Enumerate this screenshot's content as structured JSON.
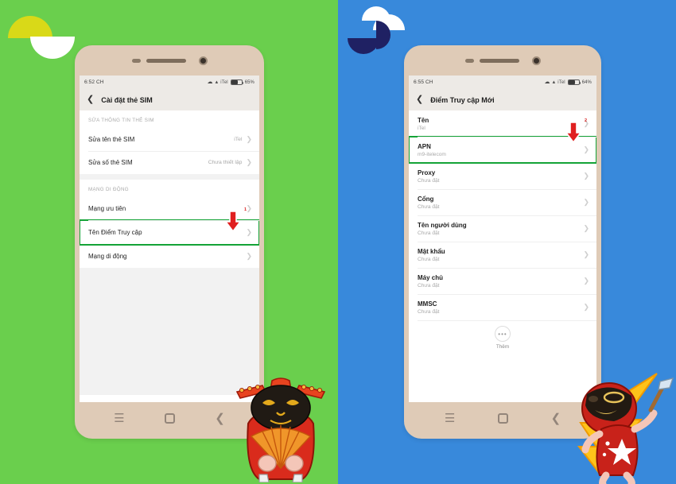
{
  "background": {
    "left_color": "#6ACF4D",
    "right_color": "#3889DB",
    "accent_yellow": "#D9D918",
    "accent_navy": "#1F2163",
    "highlight_green": "#14A337",
    "arrow_red": "#D81E1E",
    "phone_bezel": "#DFCBB7"
  },
  "left_phone": {
    "status_bar": {
      "time": "6:52 CH",
      "wifi_icon": "wifi-icon",
      "signal_icon": "signal-icon",
      "carrier": "iTel",
      "battery_icon": "battery-icon",
      "battery_percent": "65%"
    },
    "title_bar": {
      "back_icon": "chevron-left-icon",
      "title": "Cài đặt thẻ SIM"
    },
    "sections": [
      {
        "header": "SỬA THÔNG TIN THẺ SIM",
        "rows": [
          {
            "label": "Sửa tên thẻ SIM",
            "value": "iTel",
            "chevron": "chevron-right-icon",
            "highlighted": false
          },
          {
            "label": "Sửa số thẻ SIM",
            "value": "Chưa thiết lập",
            "chevron": "chevron-right-icon",
            "highlighted": false
          }
        ]
      },
      {
        "header": "MẠNG DI ĐỘNG",
        "rows": [
          {
            "label": "Mạng ưu tiên",
            "value": "",
            "chevron": "chevron-right-icon",
            "highlighted": false
          },
          {
            "label": "Tên Điểm Truy cập",
            "value": "",
            "chevron": "chevron-right-icon",
            "highlighted": true
          },
          {
            "label": "Mạng di động",
            "value": "",
            "chevron": "chevron-right-icon",
            "highlighted": false
          }
        ]
      }
    ],
    "annotation": {
      "number": "1",
      "icon": "down-arrow-annotation"
    },
    "nav_bar": {
      "menu_icon": "menu-icon",
      "home_icon": "home-icon",
      "back_icon": "back-icon"
    }
  },
  "right_phone": {
    "status_bar": {
      "time": "6:55 CH",
      "wifi_icon": "wifi-icon",
      "signal_icon": "signal-icon",
      "carrier": "iTel",
      "battery_icon": "battery-icon",
      "battery_percent": "64%"
    },
    "title_bar": {
      "back_icon": "chevron-left-icon",
      "title": "Điểm Truy cập Mới"
    },
    "rows": [
      {
        "title": "Tên",
        "value": "iTel",
        "chevron": "chevron-right-icon",
        "highlighted": false
      },
      {
        "title": "APN",
        "value": "m9-itelecom",
        "chevron": "chevron-right-icon",
        "highlighted": true
      },
      {
        "title": "Proxy",
        "value": "Chưa đặt",
        "chevron": "chevron-right-icon",
        "highlighted": false
      },
      {
        "title": "Cổng",
        "value": "Chưa đặt",
        "chevron": "chevron-right-icon",
        "highlighted": false
      },
      {
        "title": "Tên người dùng",
        "value": "Chưa đặt",
        "chevron": "chevron-right-icon",
        "highlighted": false
      },
      {
        "title": "Mật khẩu",
        "value": "Chưa đặt",
        "chevron": "chevron-right-icon",
        "highlighted": false
      },
      {
        "title": "Máy chủ",
        "value": "Chưa đặt",
        "chevron": "chevron-right-icon",
        "highlighted": false
      },
      {
        "title": "MMSC",
        "value": "Chưa đặt",
        "chevron": "chevron-right-icon",
        "highlighted": false
      }
    ],
    "more_button": {
      "icon": "ellipsis-icon",
      "dots": "•••",
      "label": "Thêm"
    },
    "annotation": {
      "number": "2",
      "icon": "down-arrow-annotation"
    },
    "nav_bar": {
      "menu_icon": "menu-icon",
      "home_icon": "home-icon",
      "back_icon": "back-icon"
    }
  },
  "decorations": {
    "top_left": "half-circle-pair-decoration",
    "top_right": "pinwheel-decoration",
    "mascot_left": "vietnamese-fan-mascot",
    "mascot_right": "star-outfit-pickaxe-mascot"
  }
}
